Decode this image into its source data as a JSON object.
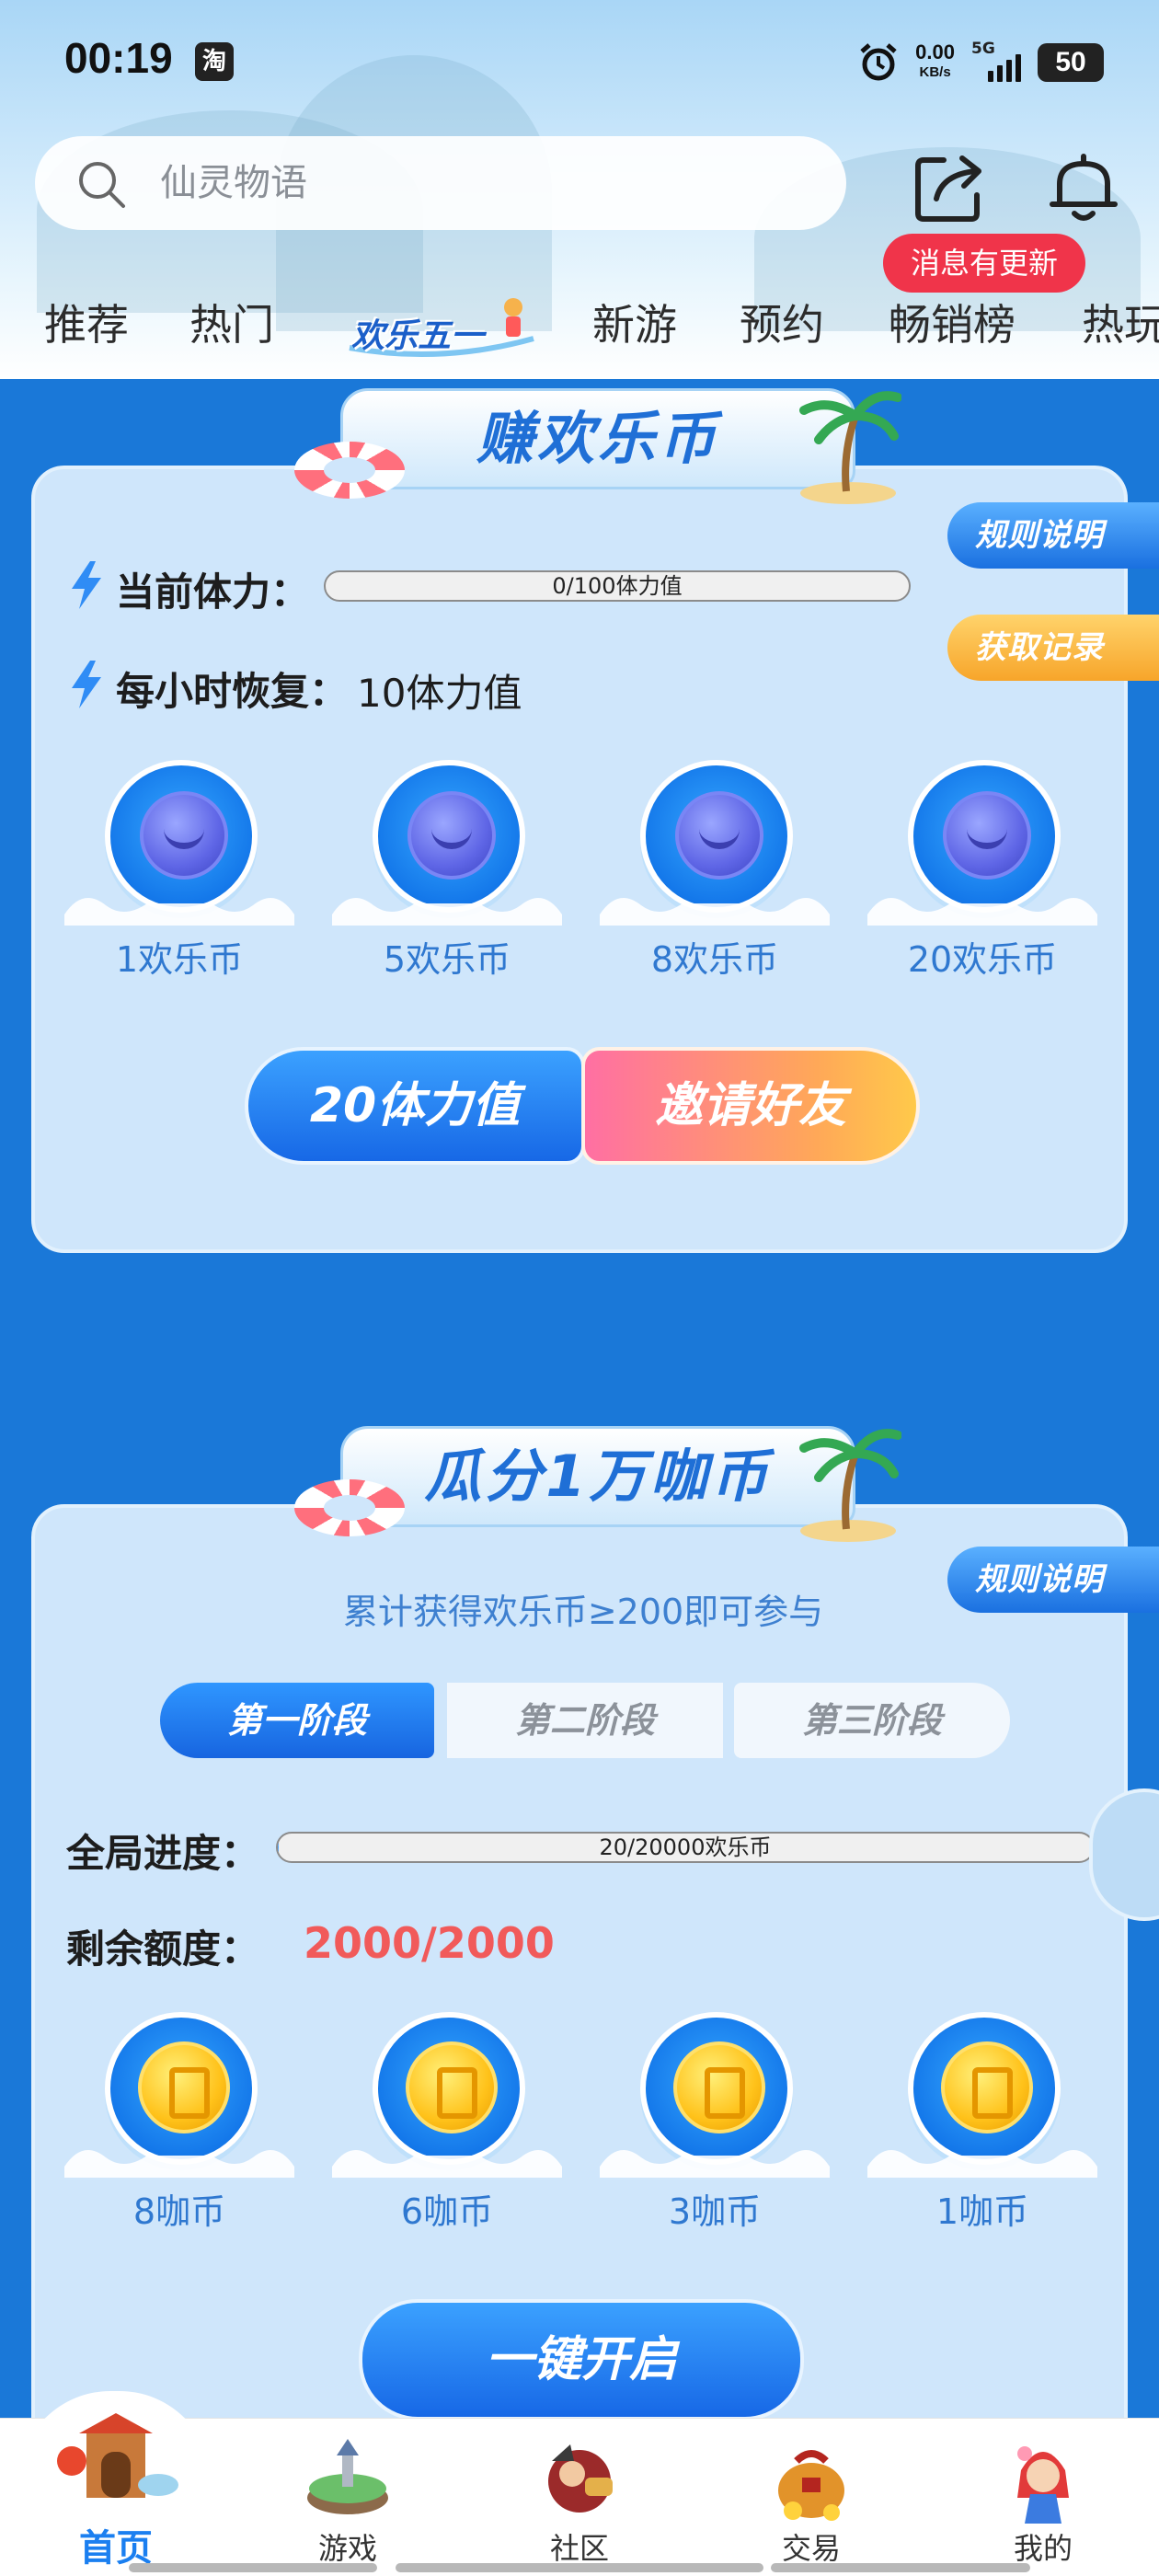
{
  "status_bar": {
    "time": "00:19",
    "app_badge": "淘",
    "net_speed_value": "0.00",
    "net_speed_unit": "KB/s",
    "signal_label": "5G",
    "battery": "50"
  },
  "header": {
    "search_placeholder": "仙灵物语",
    "message_badge": "消息有更新",
    "tabs": [
      {
        "label": "推荐"
      },
      {
        "label": "热门"
      },
      {
        "label": "欢乐五一"
      },
      {
        "label": "新游"
      },
      {
        "label": "预约"
      },
      {
        "label": "畅销榜"
      },
      {
        "label": "热玩"
      }
    ]
  },
  "earn": {
    "title": "赚欢乐币",
    "rules_label": "规则说明",
    "records_label": "获取记录",
    "stamina_label": "当前体力：",
    "stamina_progress_text": "0/100体力值",
    "stamina_fraction": 0,
    "recover_label": "每小时恢复：",
    "recover_value": "10体力值",
    "rewards": [
      {
        "label": "1欢乐币"
      },
      {
        "label": "5欢乐币"
      },
      {
        "label": "8欢乐币"
      },
      {
        "label": "20欢乐币"
      }
    ],
    "stamina_button": "20体力值",
    "invite_button": "邀请好友"
  },
  "share": {
    "title": "瓜分1万咖币",
    "rules_label": "规则说明",
    "hint": "累计获得欢乐币≥200即可参与",
    "stages": [
      {
        "label": "第一阶段"
      },
      {
        "label": "第二阶段"
      },
      {
        "label": "第三阶段"
      }
    ],
    "progress_label": "全局进度：",
    "progress_text": "20/20000欢乐币",
    "progress_fraction": 0.001,
    "remain_label": "剩余额度：",
    "remain_value": "2000/2000",
    "rewards": [
      {
        "label": "8咖币"
      },
      {
        "label": "6咖币"
      },
      {
        "label": "3咖币"
      },
      {
        "label": "1咖币"
      }
    ],
    "open_button": "一键开启"
  },
  "bottom_nav": {
    "items": [
      {
        "label": "首页"
      },
      {
        "label": "游戏"
      },
      {
        "label": "社区"
      },
      {
        "label": "交易"
      },
      {
        "label": "我的"
      }
    ]
  },
  "colors": {
    "accent_blue": "#1a78d8",
    "badge_red": "#f0344a",
    "remain_red": "#f15a5a",
    "nav_active": "#1b7ff0"
  }
}
